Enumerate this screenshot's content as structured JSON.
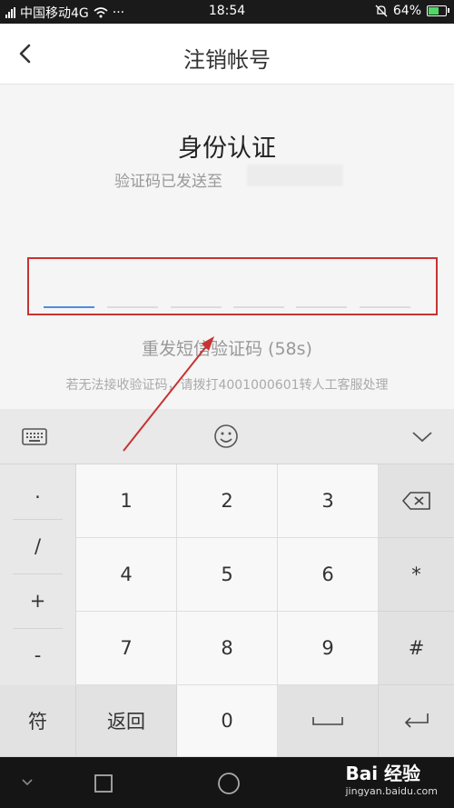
{
  "status_bar": {
    "carrier": "中国移动4G",
    "dots": "···",
    "time": "18:54",
    "battery": "64%"
  },
  "header": {
    "title": "注销帐号"
  },
  "verify": {
    "heading": "身份认证",
    "sent_to": "验证码已发送至",
    "resend": "重发短信验证码 (58s)",
    "helper": "若无法接收验证码，请拨打4001000601转人工客服处理"
  },
  "keyboard": {
    "symbols": [
      ".",
      "/",
      "+",
      "-"
    ],
    "digits": [
      "1",
      "2",
      "3",
      "4",
      "5",
      "6",
      "7",
      "8",
      "9"
    ],
    "right_keys": [
      "*",
      "#"
    ],
    "bottom": {
      "sym": "符",
      "back": "返回",
      "zero": "0"
    }
  },
  "watermark": {
    "brand": "Bai 经验",
    "url": "jingyan.baidu.com"
  },
  "colors": {
    "accent": "#4d8de0",
    "annotation_red": "#c83333"
  }
}
